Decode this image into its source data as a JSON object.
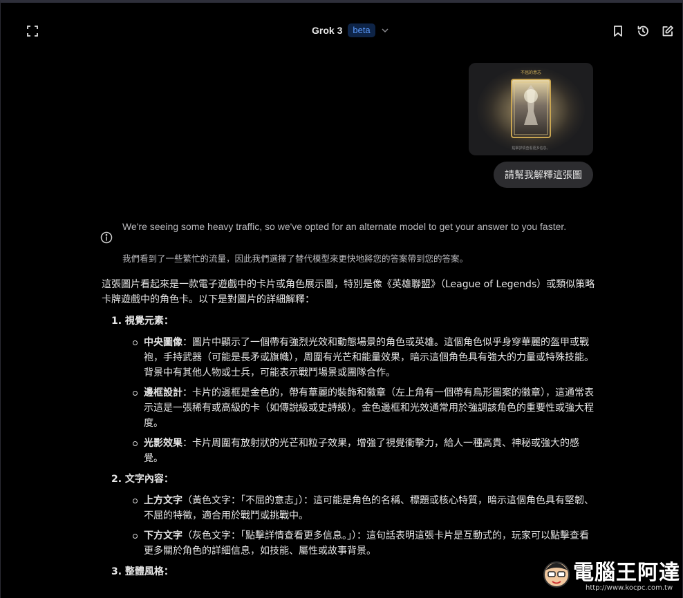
{
  "header": {
    "title": "Grok 3",
    "badge": "beta",
    "expand_icon": "fullscreen-icon",
    "chevron_icon": "chevron-down-icon",
    "bookmark_icon": "bookmark-icon",
    "history_icon": "history-icon",
    "new_chat_icon": "edit-icon"
  },
  "user_message": {
    "image_caption_top": "不屈的意志",
    "image_caption_bottom": "點擊詳情查看更多信息。",
    "text": "請幫我解釋這張圖"
  },
  "notice": {
    "icon": "info-icon",
    "text_en": "We're seeing some heavy traffic, so we've opted for an alternate model to get your answer to you faster.",
    "text_zh": "我們看到了一些繁忙的流量，因此我們選擇了替代模型來更快地將您的答案帶到您的答案。"
  },
  "answer": {
    "intro": "這張圖片看起來是一款電子遊戲中的卡片或角色展示圖，特別是像《英雄聯盟》（League of Legends）或類似策略卡牌遊戲中的角色卡。以下是對圖片的詳細解釋：",
    "sections": [
      {
        "title": "1. 視覺元素：",
        "items": [
          {
            "term": "中央圖像",
            "text": "：圖片中顯示了一個帶有強烈光效和動態場景的角色或英雄。這個角色似乎身穿華麗的盔甲或戰袍，手持武器（可能是長矛或旗幟），周圍有光芒和能量效果，暗示這個角色具有強大的力量或特殊技能。背景中有其他人物或士兵，可能表示戰鬥場景或團隊合作。"
          },
          {
            "term": "邊框設計",
            "text": "：卡片的邊框是金色的，帶有華麗的裝飾和徽章（左上角有一個帶有鳥形圖案的徽章），這通常表示這是一張稀有或高級的卡（如傳說級或史詩級）。金色邊框和光效通常用於強調該角色的重要性或強大程度。"
          },
          {
            "term": "光影效果",
            "text": "：卡片周圍有放射狀的光芒和粒子效果，增強了視覺衝擊力，給人一種高貴、神秘或強大的感覺。"
          }
        ]
      },
      {
        "title": "2. 文字內容：",
        "items": [
          {
            "term": "上方文字",
            "text": "（黃色文字：「不屈的意志」）：這可能是角色的名稱、標題或核心特質，暗示這個角色具有堅韌、不屈的特徵，適合用於戰鬥或挑戰中。"
          },
          {
            "term": "下方文字",
            "text": "（灰色文字：「點擊詳情查看更多信息。」）：這句話表明這張卡片是互動式的，玩家可以點擊查看更多關於角色的詳細信息，如技能、屬性或故事背景。"
          }
        ]
      },
      {
        "title": "3. 整體風格：",
        "items": []
      }
    ]
  },
  "watermark": {
    "text": "電腦王阿達",
    "url": "http://www.kocpc.com.tw"
  }
}
